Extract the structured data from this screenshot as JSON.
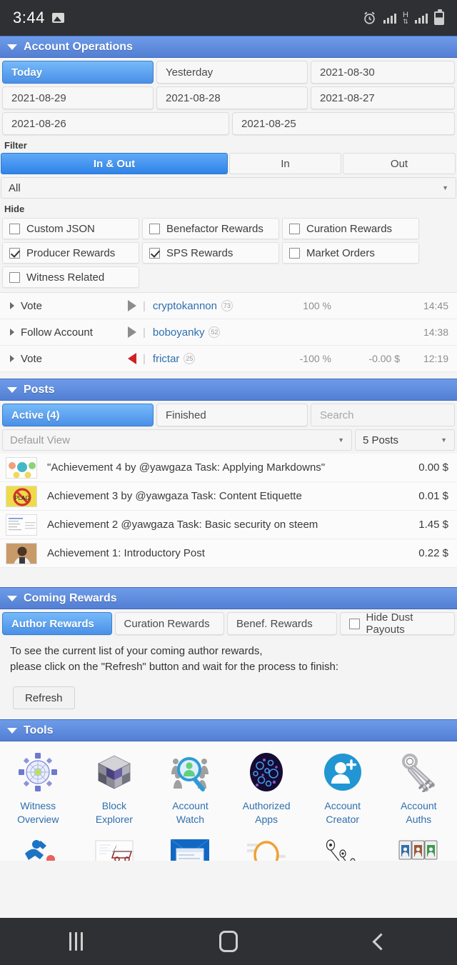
{
  "statusbar": {
    "time": "3:44",
    "network_type": "H",
    "icons": [
      "image-icon",
      "alarm-icon",
      "signal-icon",
      "hspa-data-icon",
      "signal-icon",
      "battery-icon"
    ]
  },
  "account_operations": {
    "title": "Account Operations",
    "date_tabs": [
      {
        "label": "Today",
        "active": true
      },
      {
        "label": "Yesterday",
        "active": false
      },
      {
        "label": "2021-08-30",
        "active": false
      },
      {
        "label": "2021-08-29",
        "active": false
      },
      {
        "label": "2021-08-28",
        "active": false
      },
      {
        "label": "2021-08-27",
        "active": false
      },
      {
        "label": "2021-08-26",
        "active": false
      },
      {
        "label": "2021-08-25",
        "active": false
      }
    ],
    "filter_label": "Filter",
    "filter_segments": [
      {
        "label": "In & Out",
        "active": true
      },
      {
        "label": "In",
        "active": false
      },
      {
        "label": "Out",
        "active": false
      }
    ],
    "filter_select": {
      "value": "All"
    },
    "hide_label": "Hide",
    "hide_options": [
      {
        "label": "Custom JSON",
        "checked": false
      },
      {
        "label": "Benefactor Rewards",
        "checked": false
      },
      {
        "label": "Curation Rewards",
        "checked": false
      },
      {
        "label": "Producer Rewards",
        "checked": true
      },
      {
        "label": "SPS Rewards",
        "checked": true
      },
      {
        "label": "Market Orders",
        "checked": false
      },
      {
        "label": "Witness Related",
        "checked": false
      }
    ],
    "operations": [
      {
        "type": "Vote",
        "direction": "up",
        "user": "cryptokannon",
        "reputation": "73",
        "percent": "100 %",
        "amount": "",
        "time": "14:45"
      },
      {
        "type": "Follow Account",
        "direction": "up",
        "user": "boboyanky",
        "reputation": "52",
        "percent": "",
        "amount": "",
        "time": "14:38"
      },
      {
        "type": "Vote",
        "direction": "down",
        "user": "frictar",
        "reputation": "25",
        "percent": "-100 %",
        "amount": "-0.00 $",
        "time": "12:19"
      }
    ]
  },
  "posts": {
    "title": "Posts",
    "tabs": [
      {
        "label": "Active (4)",
        "active": true
      },
      {
        "label": "Finished",
        "active": false
      }
    ],
    "search_placeholder": "Search",
    "view_select": {
      "value": "Default View"
    },
    "count_select": {
      "value": "5 Posts"
    },
    "items": [
      {
        "title": "\"Achievement 4 by @yawgaza Task: Applying Markdowns\"",
        "value": "0.00 $",
        "thumb": "markdown-diagram-thumb"
      },
      {
        "title": "Achievement 3 by @yawgaza Task: Content Etiquette",
        "value": "0.01 $",
        "thumb": "no-plagiarism-thumb"
      },
      {
        "title": "Achievement 2 @yawgaza Task: Basic security on steem",
        "value": "1.45 $",
        "thumb": "document-thumb"
      },
      {
        "title": "Achievement 1: Introductory Post",
        "value": "0.22 $",
        "thumb": "portrait-thumb"
      }
    ]
  },
  "coming_rewards": {
    "title": "Coming Rewards",
    "tabs": [
      {
        "label": "Author Rewards",
        "active": true
      },
      {
        "label": "Curation Rewards",
        "active": false
      },
      {
        "label": "Benef. Rewards",
        "active": false
      }
    ],
    "hide_dust": {
      "label": "Hide Dust Payouts",
      "checked": false
    },
    "info_line1": "To see the current list of your coming author rewards,",
    "info_line2": "please click on the \"Refresh\" button and wait for the process to finish:",
    "refresh_label": "Refresh"
  },
  "tools": {
    "title": "Tools",
    "items": [
      {
        "label_line1": "Witness",
        "label_line2": "Overview",
        "icon": "witness-network-icon"
      },
      {
        "label_line1": "Block",
        "label_line2": "Explorer",
        "icon": "block-cube-icon"
      },
      {
        "label_line1": "Account",
        "label_line2": "Watch",
        "icon": "account-watch-magnifier-icon"
      },
      {
        "label_line1": "Authorized",
        "label_line2": "Apps",
        "icon": "authorized-apps-sphere-icon"
      },
      {
        "label_line1": "Account",
        "label_line2": "Creator",
        "icon": "account-creator-add-user-icon"
      },
      {
        "label_line1": "Account",
        "label_line2": "Auths",
        "icon": "account-auths-keys-icon"
      }
    ],
    "items_row2": [
      {
        "icon": "runner-icon"
      },
      {
        "icon": "blueprint-icon"
      },
      {
        "icon": "window-screen-icon"
      },
      {
        "icon": "orange-circle-icon"
      },
      {
        "icon": "pin-map-icon"
      },
      {
        "icon": "cards-icon"
      }
    ]
  },
  "navbar": {
    "recents": "recents-button",
    "home": "home-button",
    "back": "back-button"
  },
  "colors": {
    "header_blue": "#5b87de",
    "active_blue": "#4a90e8",
    "link_blue": "#2f6fae",
    "downvote_red": "#cf2027",
    "status_bg": "#2f3033"
  }
}
